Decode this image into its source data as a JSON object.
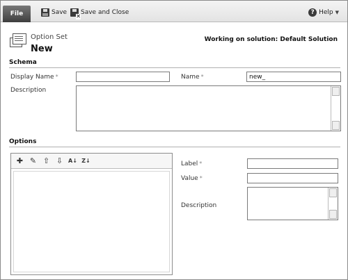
{
  "ribbon": {
    "file_label": "File",
    "save_label": "Save",
    "save_close_label": "Save and Close",
    "help_label": "Help"
  },
  "header": {
    "entity_type": "Option Set",
    "title": "New",
    "solution_text": "Working on solution: Default Solution"
  },
  "schema": {
    "section_title": "Schema",
    "display_name_label": "Display Name",
    "display_name_value": "",
    "name_label": "Name",
    "name_value": "new_",
    "description_label": "Description",
    "description_value": ""
  },
  "options": {
    "section_title": "Options",
    "toolbar_icons": [
      "add-icon",
      "edit-icon",
      "move-up-icon",
      "move-down-icon",
      "sort-ascending-icon",
      "sort-descending-icon"
    ],
    "label_label": "Label",
    "label_value": "",
    "value_label": "Value",
    "value_value": "",
    "description_label": "Description",
    "description_value": ""
  },
  "required_marker": "*"
}
